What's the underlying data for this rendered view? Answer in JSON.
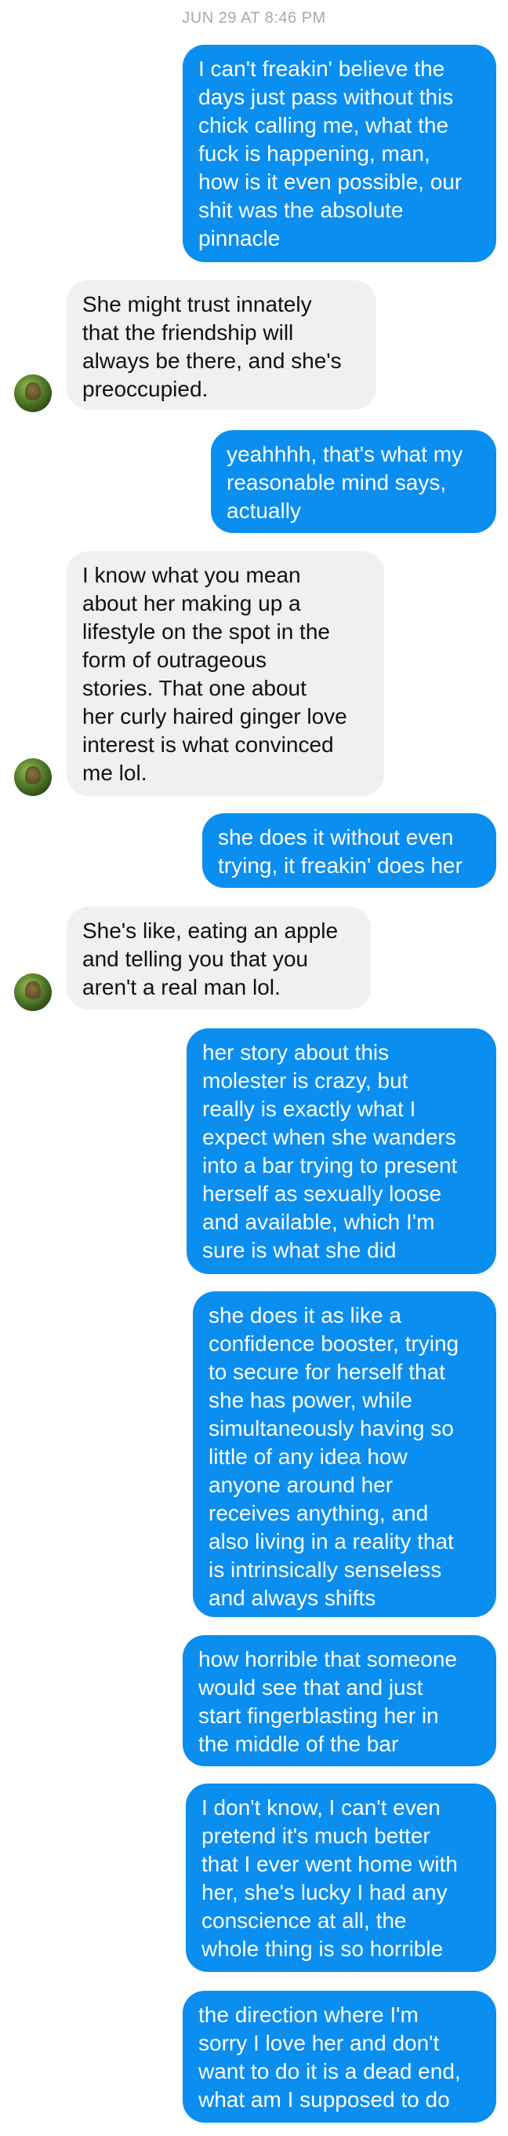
{
  "header": {
    "timestamp": "JUN 29 AT 8:46 PM"
  },
  "contact": {
    "avatar_icon": "contact-avatar-photo"
  },
  "colors": {
    "outgoing": "#0a8ef0",
    "incoming": "#f0f0f0"
  },
  "messages": [
    {
      "direction": "outgoing",
      "text": "I can't freakin' believe the\ndays just pass without this\nchick calling me, what the\nfuck is happening, man,\nhow is it even possible, our\nshit was the absolute\npinnacle"
    },
    {
      "direction": "incoming",
      "text": "She might trust innately\nthat the friendship will\nalways be there, and she's\npreoccupied."
    },
    {
      "direction": "outgoing",
      "text": "yeahhhh, that's what my\nreasonable mind says,\nactually"
    },
    {
      "direction": "incoming",
      "text": "I know what you mean\nabout her making up a\nlifestyle on the spot in the\nform of outrageous\nstories. That one about\nher curly haired ginger love\ninterest is what convinced\nme lol."
    },
    {
      "direction": "outgoing",
      "text": "she does it without even\ntrying, it freakin' does her"
    },
    {
      "direction": "incoming",
      "text": "She's like, eating an apple\nand telling you that you\naren't a real man lol."
    },
    {
      "direction": "outgoing",
      "text": "her story about this\nmolester is crazy, but\nreally is exactly what I\nexpect when she wanders\ninto a bar trying to present\nherself as sexually loose\nand available, which I'm\nsure is what she did"
    },
    {
      "direction": "outgoing",
      "text": "she does it as like a\nconfidence booster, trying\nto secure for herself that\nshe has power, while\nsimultaneously having so\nlittle of any idea how\nanyone around her\nreceives anything, and\nalso living in a reality that\nis intrinsically senseless\nand always shifts"
    },
    {
      "direction": "outgoing",
      "text": "how horrible that someone\nwould see that and just\nstart fingerblasting her in\nthe middle of the bar"
    },
    {
      "direction": "outgoing",
      "text": "I don't know, I can't even\npretend it's much better\nthat I ever went home with\nher, she's lucky I had any\nconscience at all, the\nwhole thing is so horrible"
    },
    {
      "direction": "outgoing",
      "text": "the direction where I'm\nsorry I love her and don't\nwant to do it is a dead end,\nwhat am I supposed to do"
    }
  ]
}
